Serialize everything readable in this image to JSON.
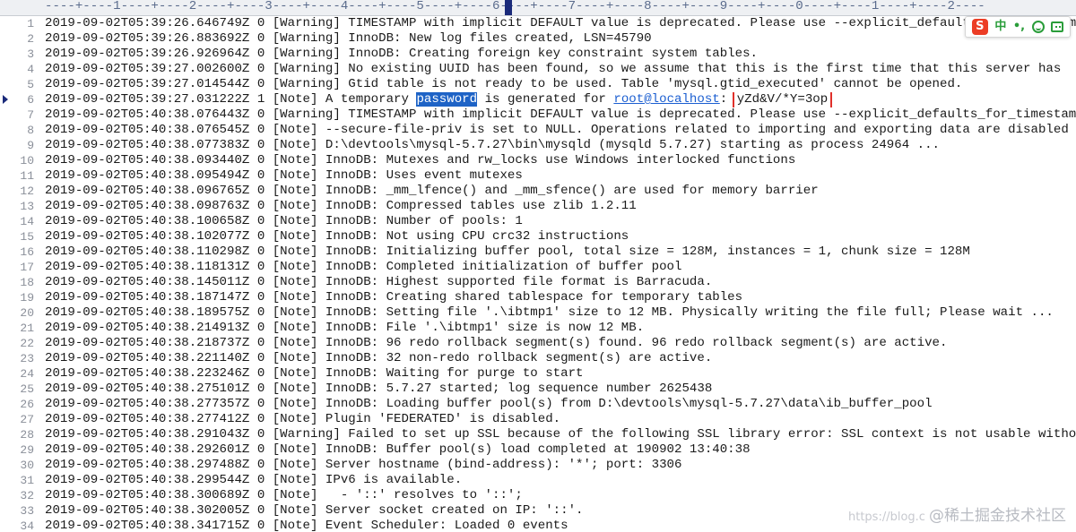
{
  "ruler": {
    "text": "----+----1----+----2----+----3----+----4----+----5----+----6----+----7----+----8----+----9----+----0----+----1----+----2----"
  },
  "ime": {
    "logo": "S",
    "lang": "中",
    "punct": "•,",
    "smile_icon": "smile-icon",
    "grid_icon": "keyboard-grid-icon"
  },
  "watermark": {
    "url": "https://blog.c",
    "brand": "@稀土掘金技术社区"
  },
  "lines": [
    {
      "n": "1",
      "text": "2019-09-02T05:39:26.646749Z 0 [Warning] TIMESTAMP with implicit DEFAULT value is deprecated. Please use --explicit_defaults_for_timestamp"
    },
    {
      "n": "2",
      "text": "2019-09-02T05:39:26.883692Z 0 [Warning] InnoDB: New log files created, LSN=45790"
    },
    {
      "n": "3",
      "text": "2019-09-02T05:39:26.926964Z 0 [Warning] InnoDB: Creating foreign key constraint system tables."
    },
    {
      "n": "4",
      "text": "2019-09-02T05:39:27.002600Z 0 [Warning] No existing UUID has been found, so we assume that this is the first time that this server has"
    },
    {
      "n": "5",
      "text": "2019-09-02T05:39:27.014544Z 0 [Warning] Gtid table is not ready to be used. Table 'mysql.gtid_executed' cannot be opened."
    },
    {
      "n": "6",
      "prefix": "2019-09-02T05:39:27.031222Z 1 [Note] A temporary ",
      "hl": "password",
      "mid": " is generated for ",
      "link": "root@localhost",
      "colon": ": ",
      "box": "yZd&V/*Y=3op"
    },
    {
      "n": "7",
      "text": "2019-09-02T05:40:38.076443Z 0 [Warning] TIMESTAMP with implicit DEFAULT value is deprecated. Please use --explicit_defaults_for_timestamp"
    },
    {
      "n": "8",
      "text": "2019-09-02T05:40:38.076545Z 0 [Note] --secure-file-priv is set to NULL. Operations related to importing and exporting data are disabled"
    },
    {
      "n": "9",
      "text": "2019-09-02T05:40:38.077383Z 0 [Note] D:\\devtools\\mysql-5.7.27\\bin\\mysqld (mysqld 5.7.27) starting as process 24964 ..."
    },
    {
      "n": "10",
      "text": "2019-09-02T05:40:38.093440Z 0 [Note] InnoDB: Mutexes and rw_locks use Windows interlocked functions"
    },
    {
      "n": "11",
      "text": "2019-09-02T05:40:38.095494Z 0 [Note] InnoDB: Uses event mutexes"
    },
    {
      "n": "12",
      "text": "2019-09-02T05:40:38.096765Z 0 [Note] InnoDB: _mm_lfence() and _mm_sfence() are used for memory barrier"
    },
    {
      "n": "13",
      "text": "2019-09-02T05:40:38.098763Z 0 [Note] InnoDB: Compressed tables use zlib 1.2.11"
    },
    {
      "n": "14",
      "text": "2019-09-02T05:40:38.100658Z 0 [Note] InnoDB: Number of pools: 1"
    },
    {
      "n": "15",
      "text": "2019-09-02T05:40:38.102077Z 0 [Note] InnoDB: Not using CPU crc32 instructions"
    },
    {
      "n": "16",
      "text": "2019-09-02T05:40:38.110298Z 0 [Note] InnoDB: Initializing buffer pool, total size = 128M, instances = 1, chunk size = 128M"
    },
    {
      "n": "17",
      "text": "2019-09-02T05:40:38.118131Z 0 [Note] InnoDB: Completed initialization of buffer pool"
    },
    {
      "n": "18",
      "text": "2019-09-02T05:40:38.145011Z 0 [Note] InnoDB: Highest supported file format is Barracuda."
    },
    {
      "n": "19",
      "text": "2019-09-02T05:40:38.187147Z 0 [Note] InnoDB: Creating shared tablespace for temporary tables"
    },
    {
      "n": "20",
      "text": "2019-09-02T05:40:38.189575Z 0 [Note] InnoDB: Setting file '.\\ibtmp1' size to 12 MB. Physically writing the file full; Please wait ..."
    },
    {
      "n": "21",
      "text": "2019-09-02T05:40:38.214913Z 0 [Note] InnoDB: File '.\\ibtmp1' size is now 12 MB."
    },
    {
      "n": "22",
      "text": "2019-09-02T05:40:38.218737Z 0 [Note] InnoDB: 96 redo rollback segment(s) found. 96 redo rollback segment(s) are active."
    },
    {
      "n": "23",
      "text": "2019-09-02T05:40:38.221140Z 0 [Note] InnoDB: 32 non-redo rollback segment(s) are active."
    },
    {
      "n": "24",
      "text": "2019-09-02T05:40:38.223246Z 0 [Note] InnoDB: Waiting for purge to start"
    },
    {
      "n": "25",
      "text": "2019-09-02T05:40:38.275101Z 0 [Note] InnoDB: 5.7.27 started; log sequence number 2625438"
    },
    {
      "n": "26",
      "text": "2019-09-02T05:40:38.277357Z 0 [Note] InnoDB: Loading buffer pool(s) from D:\\devtools\\mysql-5.7.27\\data\\ib_buffer_pool"
    },
    {
      "n": "27",
      "text": "2019-09-02T05:40:38.277412Z 0 [Note] Plugin 'FEDERATED' is disabled."
    },
    {
      "n": "28",
      "text": "2019-09-02T05:40:38.291043Z 0 [Warning] Failed to set up SSL because of the following SSL library error: SSL context is not usable witho"
    },
    {
      "n": "29",
      "text": "2019-09-02T05:40:38.292601Z 0 [Note] InnoDB: Buffer pool(s) load completed at 190902 13:40:38"
    },
    {
      "n": "30",
      "text": "2019-09-02T05:40:38.297488Z 0 [Note] Server hostname (bind-address): '*'; port: 3306"
    },
    {
      "n": "31",
      "text": "2019-09-02T05:40:38.299544Z 0 [Note] IPv6 is available."
    },
    {
      "n": "32",
      "text": "2019-09-02T05:40:38.300689Z 0 [Note]   - '::' resolves to '::';"
    },
    {
      "n": "33",
      "text": "2019-09-02T05:40:38.302005Z 0 [Note] Server socket created on IP: '::'."
    },
    {
      "n": "34",
      "text": "2019-09-02T05:40:38.341715Z 0 [Note] Event Scheduler: Loaded 0 events"
    }
  ]
}
